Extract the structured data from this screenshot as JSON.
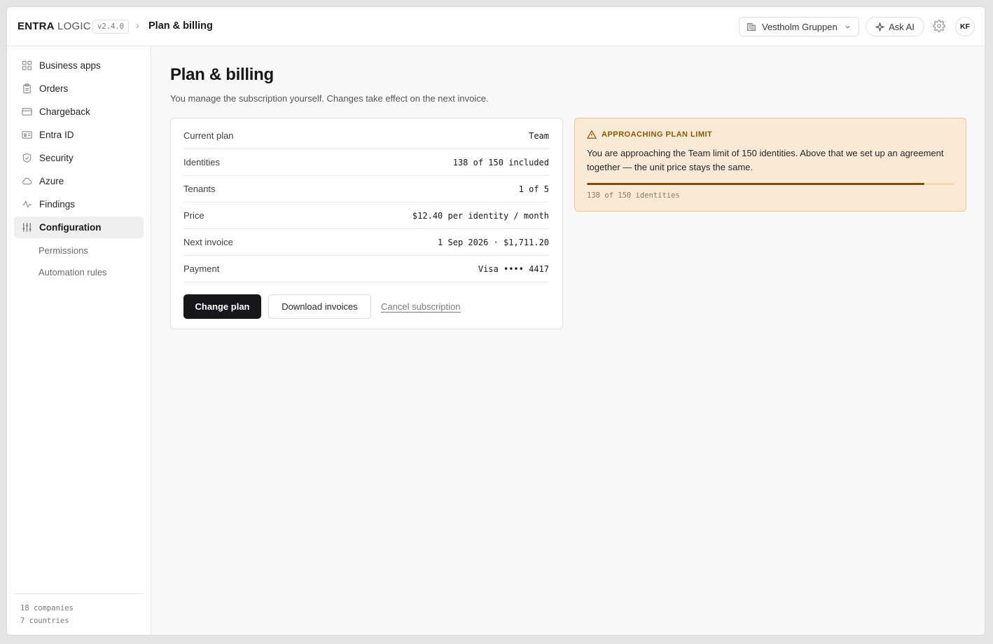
{
  "header": {
    "brand_bold": "ENTRA",
    "brand_light": "LOGIC",
    "version": "v2.4.0",
    "breadcrumb_sep": "›",
    "breadcrumb": "Plan & billing",
    "org_name": "Vestholm Gruppen",
    "ask_ai": "Ask AI",
    "avatar": "KF"
  },
  "sidebar": {
    "items": [
      {
        "label": "Business apps",
        "icon": "grid-icon"
      },
      {
        "label": "Orders",
        "icon": "clipboard-icon"
      },
      {
        "label": "Chargeback",
        "icon": "card-icon"
      },
      {
        "label": "Entra ID",
        "icon": "id-card-icon"
      },
      {
        "label": "Security",
        "icon": "shield-icon"
      },
      {
        "label": "Azure",
        "icon": "cloud-icon"
      },
      {
        "label": "Findings",
        "icon": "activity-icon"
      },
      {
        "label": "Configuration",
        "icon": "sliders-icon",
        "active": true
      }
    ],
    "sub_items": [
      "Permissions",
      "Automation rules"
    ],
    "footer": [
      "18 companies",
      "7 countries"
    ]
  },
  "main": {
    "title": "Plan & billing",
    "subtitle": "You manage the subscription yourself. Changes take effect on the next invoice.",
    "rows": [
      {
        "label": "Current plan",
        "value": "Team"
      },
      {
        "label": "Identities",
        "value": "138 of 150 included"
      },
      {
        "label": "Tenants",
        "value": "1 of 5"
      },
      {
        "label": "Price",
        "value": "$12.40 per identity / month"
      },
      {
        "label": "Next invoice",
        "value": "1 Sep 2026 · $1,711.20"
      },
      {
        "label": "Payment",
        "value": "Visa •••• 4417"
      }
    ],
    "change_plan": "Change plan",
    "download_invoices": "Download invoices",
    "cancel_subscription": "Cancel subscription"
  },
  "alert": {
    "title": "APPROACHING PLAN LIMIT",
    "body": "You are approaching the Team limit of 150 identities. Above that we set up an agreement together — the unit price stays the same.",
    "usage_text": "138 of 150 identities",
    "used": 138,
    "limit": 150,
    "colors": {
      "background": "#f8ead5",
      "accent": "#8a5a00"
    }
  }
}
